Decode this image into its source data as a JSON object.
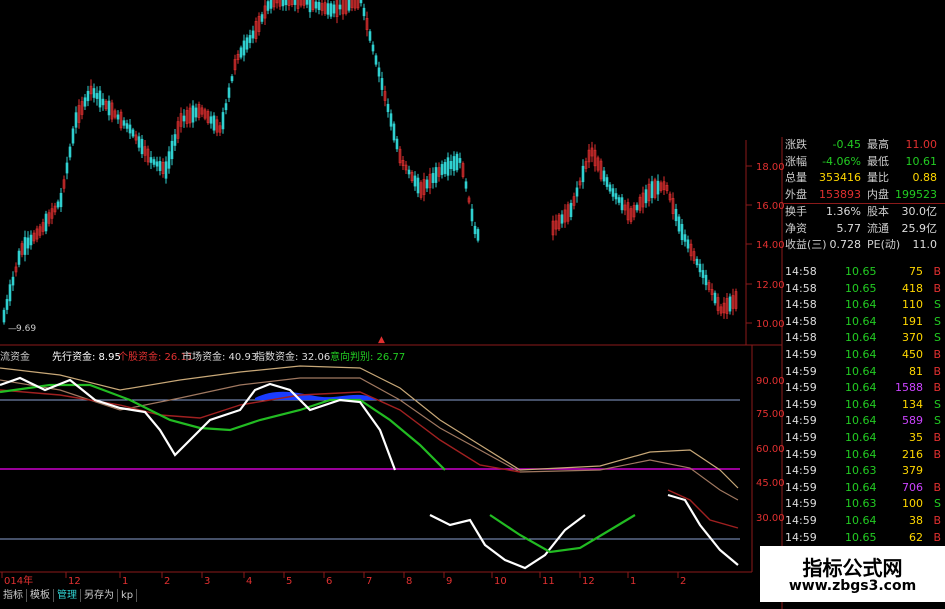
{
  "colors": {
    "up": "#e03030",
    "down": "#30d0d0",
    "yellow": "#ffd700",
    "white": "#ffffff",
    "green": "#22cc22",
    "grid": "#8b1a1a",
    "purple": "#cc00cc"
  },
  "price_axis": {
    "ticks": [
      "18.00",
      "16.00",
      "14.00",
      "12.00",
      "10.00"
    ]
  },
  "low_marker": "9.69",
  "indicator": {
    "items": [
      {
        "label": "流资金",
        "value": "",
        "color": "#cccccc"
      },
      {
        "label": "先行资金:",
        "value": "8.95",
        "color": "#ffffff"
      },
      {
        "label": "个股资金:",
        "value": "26.11",
        "color": "#e03030"
      },
      {
        "label": "市场资金:",
        "value": "40.93",
        "color": "#dddddd"
      },
      {
        "label": "指数资金:",
        "value": "32.06",
        "color": "#dddddd"
      },
      {
        "label": "意向判别:",
        "value": "26.77",
        "color": "#22cc22"
      }
    ],
    "axis_ticks": [
      "90.00",
      "75.00",
      "60.00",
      "45.00",
      "30.00"
    ]
  },
  "time_axis": {
    "labels": [
      "014年",
      "12",
      "1",
      "2",
      "3",
      "4",
      "5",
      "6",
      "7",
      "8",
      "9",
      "10",
      "11",
      "12",
      "1",
      "2"
    ]
  },
  "quote": {
    "rows": [
      {
        "l1": "涨跌",
        "v1": "-0.45",
        "l2": "最高",
        "v2": "11.00",
        "c1": "#22cc22",
        "c2": "#e03030"
      },
      {
        "l1": "涨幅",
        "v1": "-4.06%",
        "l2": "最低",
        "v2": "10.61",
        "c1": "#22cc22",
        "c2": "#22cc22"
      },
      {
        "l1": "总量",
        "v1": "353416",
        "l2": "量比",
        "v2": "0.88",
        "c1": "#ffd700",
        "c2": "#ffd700"
      },
      {
        "l1": "外盘",
        "v1": "153893",
        "l2": "内盘",
        "v2": "199523",
        "c1": "#e03030",
        "c2": "#22cc22"
      },
      {
        "l1": "换手",
        "v1": "1.36%",
        "l2": "股本",
        "v2": "30.0亿",
        "c1": "#dddddd",
        "c2": "#dddddd"
      },
      {
        "l1": "净资",
        "v1": "5.77",
        "l2": "流通",
        "v2": "25.9亿",
        "c1": "#dddddd",
        "c2": "#dddddd"
      },
      {
        "l1": "收益(三)",
        "v1": "0.728",
        "l2": "PE(动)",
        "v2": "11.0",
        "c1": "#dddddd",
        "c2": "#dddddd"
      }
    ]
  },
  "trades": [
    {
      "t": "14:58",
      "p": "10.65",
      "v": "75",
      "s": "B",
      "vc": "#ffd700"
    },
    {
      "t": "14:58",
      "p": "10.65",
      "v": "418",
      "s": "B",
      "vc": "#ffd700"
    },
    {
      "t": "14:58",
      "p": "10.64",
      "v": "110",
      "s": "S",
      "vc": "#ffd700"
    },
    {
      "t": "14:58",
      "p": "10.64",
      "v": "191",
      "s": "S",
      "vc": "#ffd700"
    },
    {
      "t": "14:58",
      "p": "10.64",
      "v": "370",
      "s": "S",
      "vc": "#ffd700"
    },
    {
      "t": "14:59",
      "p": "10.64",
      "v": "450",
      "s": "B",
      "vc": "#ffd700"
    },
    {
      "t": "14:59",
      "p": "10.64",
      "v": "81",
      "s": "B",
      "vc": "#ffd700"
    },
    {
      "t": "14:59",
      "p": "10.64",
      "v": "1588",
      "s": "B",
      "vc": "#cc44ff"
    },
    {
      "t": "14:59",
      "p": "10.64",
      "v": "134",
      "s": "S",
      "vc": "#ffd700"
    },
    {
      "t": "14:59",
      "p": "10.64",
      "v": "589",
      "s": "S",
      "vc": "#cc44ff"
    },
    {
      "t": "14:59",
      "p": "10.64",
      "v": "35",
      "s": "B",
      "vc": "#ffd700"
    },
    {
      "t": "14:59",
      "p": "10.64",
      "v": "216",
      "s": "B",
      "vc": "#ffd700"
    },
    {
      "t": "14:59",
      "p": "10.63",
      "v": "379",
      "s": "",
      "vc": "#ffd700"
    },
    {
      "t": "14:59",
      "p": "10.64",
      "v": "706",
      "s": "B",
      "vc": "#cc44ff"
    },
    {
      "t": "14:59",
      "p": "10.63",
      "v": "100",
      "s": "S",
      "vc": "#ffd700"
    },
    {
      "t": "14:59",
      "p": "10.64",
      "v": "38",
      "s": "B",
      "vc": "#ffd700"
    },
    {
      "t": "14:59",
      "p": "10.65",
      "v": "62",
      "s": "B",
      "vc": "#ffd700"
    }
  ],
  "watermark": {
    "title": "指标公式网",
    "url": "www.zbgs3.com"
  },
  "tabs": [
    "指标",
    "模板",
    "管理",
    "另存为",
    "kp"
  ]
}
